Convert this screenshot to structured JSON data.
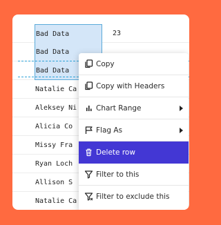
{
  "table": {
    "rows": [
      {
        "name": "Bad Data",
        "value": "23",
        "selected": true
      },
      {
        "name": "Bad Data",
        "value": "",
        "selected": true
      },
      {
        "name": "Bad Data",
        "value": "",
        "selected": true
      },
      {
        "name": "Natalie Ca",
        "value": ""
      },
      {
        "name": "Aleksey Ni",
        "value": ""
      },
      {
        "name": "Alicia Co",
        "value": ""
      },
      {
        "name": "Missy Fra",
        "value": ""
      },
      {
        "name": "Ryan Loch",
        "value": ""
      },
      {
        "name": "Allison S",
        "value": ""
      },
      {
        "name": "Natalie Ca",
        "value": ""
      }
    ]
  },
  "context_menu": {
    "items": [
      {
        "label": "Copy",
        "icon": "copy-icon"
      },
      {
        "label": "Copy with Headers",
        "icon": "copy-icon"
      },
      {
        "label": "Chart Range",
        "icon": "bar-chart-icon",
        "submenu": true
      },
      {
        "label": "Flag As",
        "icon": "flag-icon",
        "submenu": true
      },
      {
        "label": "Delete row",
        "icon": "trash-icon",
        "active": true
      },
      {
        "label": "Filter to this",
        "icon": "filter-icon"
      },
      {
        "label": "Filter to exclude this",
        "icon": "filter-exclude-icon"
      }
    ]
  },
  "colors": {
    "background": "#FF6A40",
    "selection_fill": "#D4E6F8",
    "selection_border": "#5AAAD9",
    "menu_active": "#4337D4"
  }
}
